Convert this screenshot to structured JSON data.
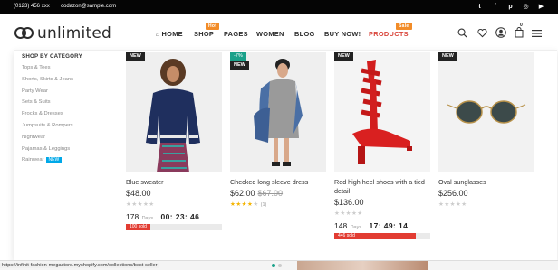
{
  "topbar": {
    "phone": "(0123) 456 xxx",
    "email": "codazon@sample.com",
    "socials": [
      "twitter-icon",
      "facebook-icon",
      "pinterest-icon",
      "instagram-icon",
      "youtube-icon"
    ],
    "social_glyphs": [
      "t",
      "f",
      "p",
      "◎",
      "▶"
    ]
  },
  "brand": {
    "name": "unlimited"
  },
  "nav": {
    "home": "HOME",
    "shop": "SHOP",
    "shop_badge": "Hot",
    "pages": "PAGES",
    "women": "WOMEN",
    "blog": "BLOG",
    "buy": "BUY NOW!",
    "products": "PRODUCTS",
    "products_badge": "Sale"
  },
  "header_icons": {
    "cart_count": "0"
  },
  "colors": {
    "sale_red": "#e23c32",
    "accent_orange": "#f28c28",
    "teal": "#1aa18a",
    "new_blue": "#00a8e8"
  },
  "menu": {
    "category_title": "SHOP BY CATEGORY",
    "categories": [
      "Tops & Tees",
      "Shorts, Skirts & Jeans",
      "Party Wear",
      "Sets & Suits",
      "Frocks & Dresses",
      "Jumpsuits & Rompers",
      "Nightwear",
      "Pajamas & Leggings",
      "Rainwear"
    ],
    "new_label": "NEW"
  },
  "products": [
    {
      "name": "Blue sweater",
      "price": "$48.00",
      "old_price": "",
      "flags": [
        "NEW"
      ],
      "rating": 0,
      "rating_count": "",
      "stars": "★★★★★",
      "countdown": {
        "days": "178",
        "days_label": "Days",
        "time": "00: 23: 46"
      },
      "sold_label": "100 sold",
      "sold_fraction": 0.25
    },
    {
      "name": "Checked long sleeve dress",
      "price": "$62.00",
      "old_price": "$67.00",
      "flags": [
        "-7%",
        "NEW"
      ],
      "rating": 4,
      "rating_count": "(1)",
      "stars": "★★★★★"
    },
    {
      "name": "Red high heel shoes with a tied detail",
      "price": "$136.00",
      "old_price": "",
      "flags": [
        "NEW"
      ],
      "rating": 0,
      "rating_count": "",
      "stars": "★★★★★",
      "countdown": {
        "days": "148",
        "days_label": "Days",
        "time": "17: 49: 14"
      },
      "sold_label": "446 sold",
      "sold_fraction": 0.85
    },
    {
      "name": "Oval sunglasses",
      "price": "$256.00",
      "old_price": "",
      "flags": [
        "NEW"
      ],
      "rating": 0,
      "rating_count": "",
      "stars": "★★★★★"
    }
  ],
  "status": {
    "url": "https://infinit-fashion-megastore.myshopify.com/collections/best-seller"
  }
}
